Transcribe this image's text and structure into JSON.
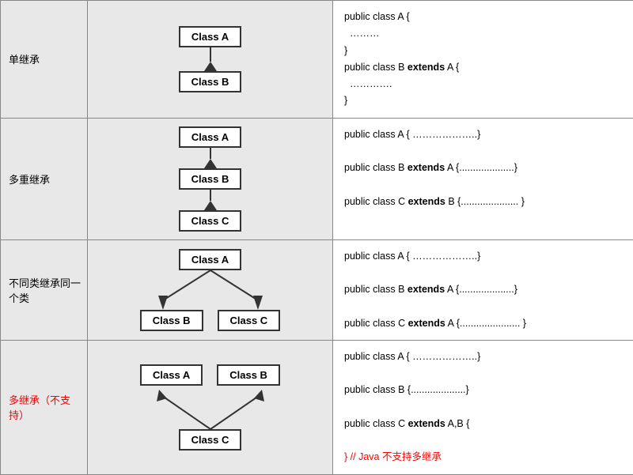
{
  "rows": [
    {
      "label": "单继承",
      "label_color": "#000",
      "code_lines": [
        {
          "text": "public class A {",
          "bold_parts": []
        },
        {
          "text": "………",
          "bold_parts": [],
          "indent": true
        },
        {
          "text": "}",
          "bold_parts": []
        },
        {
          "text": "public class B extends A {",
          "bold_parts": [
            "extends"
          ]
        },
        {
          "text": "………….",
          "bold_parts": [],
          "indent": true
        },
        {
          "text": "}",
          "bold_parts": []
        }
      ]
    },
    {
      "label": "多重继承",
      "label_color": "#000",
      "code_lines": [
        {
          "text": "public class A { ………………..}",
          "bold_parts": []
        },
        {
          "text": "",
          "bold_parts": []
        },
        {
          "text": "public class B extends A {....................}",
          "bold_parts": [
            "extends"
          ]
        },
        {
          "text": "",
          "bold_parts": []
        },
        {
          "text": "public class C extends  B {..................... }",
          "bold_parts": [
            "extends"
          ]
        }
      ]
    },
    {
      "label": "不同类继承同一个类",
      "label_color": "#000",
      "code_lines": [
        {
          "text": "public class A { ………………..}",
          "bold_parts": []
        },
        {
          "text": "",
          "bold_parts": []
        },
        {
          "text": "public class B extends A {....................}",
          "bold_parts": [
            "extends"
          ]
        },
        {
          "text": "",
          "bold_parts": []
        },
        {
          "text": "public class C extends A {...................... }",
          "bold_parts": [
            "extends"
          ]
        }
      ]
    },
    {
      "label": "多继承（不支持）",
      "label_color": "red",
      "code_lines": [
        {
          "text": "public class A { ………………..}",
          "bold_parts": [],
          "color": "#000"
        },
        {
          "text": "",
          "bold_parts": []
        },
        {
          "text": "public class B {....................}",
          "bold_parts": [],
          "color": "#000"
        },
        {
          "text": "",
          "bold_parts": []
        },
        {
          "text": "public class C extends  A,B {",
          "bold_parts": [
            "extends"
          ],
          "color": "#000"
        },
        {
          "text": "",
          "bold_parts": []
        },
        {
          "text": "} // Java  不支持多继承",
          "bold_parts": [
            "不支持多继承"
          ],
          "color": "red"
        }
      ]
    }
  ],
  "class_labels": {
    "A": "Class A",
    "B": "Class B",
    "C": "Class C"
  }
}
